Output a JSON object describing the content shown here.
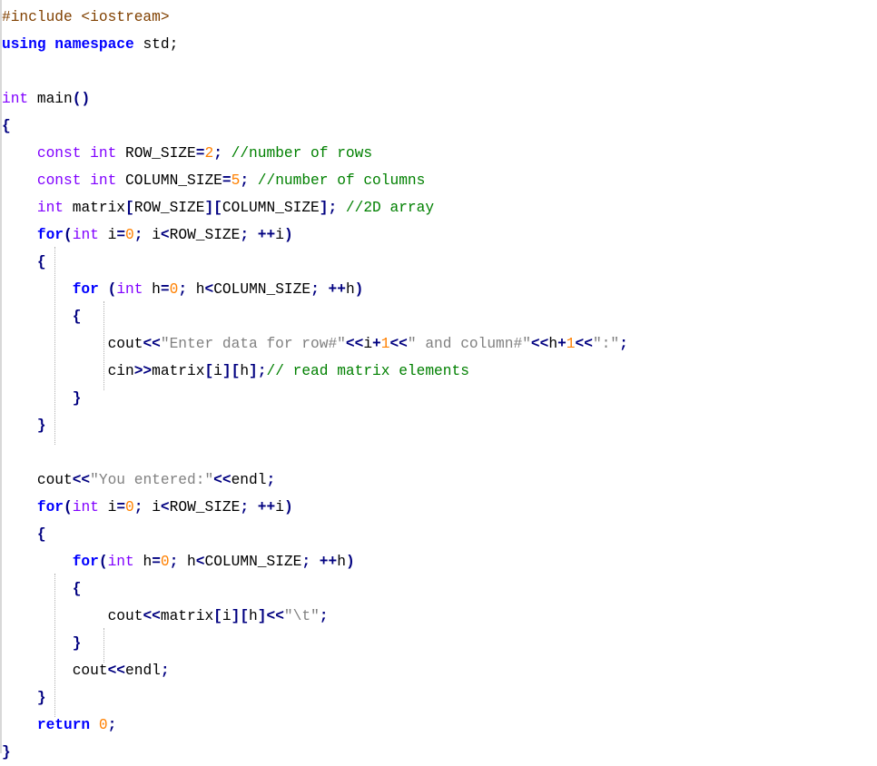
{
  "editor": {
    "language": "C++",
    "lines": [
      [
        {
          "c": "t-pre",
          "t": "#include <iostream>"
        }
      ],
      [
        {
          "c": "t-kw",
          "t": "using"
        },
        {
          "c": "t-plain",
          "t": " "
        },
        {
          "c": "t-kw",
          "t": "namespace"
        },
        {
          "c": "t-plain",
          "t": " std;"
        }
      ],
      [],
      [
        {
          "c": "t-type",
          "t": "int"
        },
        {
          "c": "t-plain",
          "t": " main"
        },
        {
          "c": "t-op",
          "t": "()"
        }
      ],
      [
        {
          "c": "t-op",
          "t": "{"
        }
      ],
      [
        {
          "c": "t-plain",
          "t": "    "
        },
        {
          "c": "t-type",
          "t": "const"
        },
        {
          "c": "t-plain",
          "t": " "
        },
        {
          "c": "t-type",
          "t": "int"
        },
        {
          "c": "t-plain",
          "t": " ROW_SIZE"
        },
        {
          "c": "t-op",
          "t": "="
        },
        {
          "c": "t-num",
          "t": "2"
        },
        {
          "c": "t-op",
          "t": ";"
        },
        {
          "c": "t-plain",
          "t": " "
        },
        {
          "c": "t-cmt",
          "t": "//number of rows"
        }
      ],
      [
        {
          "c": "t-plain",
          "t": "    "
        },
        {
          "c": "t-type",
          "t": "const"
        },
        {
          "c": "t-plain",
          "t": " "
        },
        {
          "c": "t-type",
          "t": "int"
        },
        {
          "c": "t-plain",
          "t": " COLUMN_SIZE"
        },
        {
          "c": "t-op",
          "t": "="
        },
        {
          "c": "t-num",
          "t": "5"
        },
        {
          "c": "t-op",
          "t": ";"
        },
        {
          "c": "t-plain",
          "t": " "
        },
        {
          "c": "t-cmt",
          "t": "//number of columns"
        }
      ],
      [
        {
          "c": "t-plain",
          "t": "    "
        },
        {
          "c": "t-type",
          "t": "int"
        },
        {
          "c": "t-plain",
          "t": " matrix"
        },
        {
          "c": "t-op",
          "t": "["
        },
        {
          "c": "t-plain",
          "t": "ROW_SIZE"
        },
        {
          "c": "t-op",
          "t": "]["
        },
        {
          "c": "t-plain",
          "t": "COLUMN_SIZE"
        },
        {
          "c": "t-op",
          "t": "];"
        },
        {
          "c": "t-plain",
          "t": " "
        },
        {
          "c": "t-cmt",
          "t": "//2D array"
        }
      ],
      [
        {
          "c": "t-plain",
          "t": "    "
        },
        {
          "c": "t-kw",
          "t": "for"
        },
        {
          "c": "t-op",
          "t": "("
        },
        {
          "c": "t-type",
          "t": "int"
        },
        {
          "c": "t-plain",
          "t": " i"
        },
        {
          "c": "t-op",
          "t": "="
        },
        {
          "c": "t-num",
          "t": "0"
        },
        {
          "c": "t-op",
          "t": ";"
        },
        {
          "c": "t-plain",
          "t": " i"
        },
        {
          "c": "t-op",
          "t": "<"
        },
        {
          "c": "t-plain",
          "t": "ROW_SIZE"
        },
        {
          "c": "t-op",
          "t": ";"
        },
        {
          "c": "t-plain",
          "t": " "
        },
        {
          "c": "t-op",
          "t": "++"
        },
        {
          "c": "t-plain",
          "t": "i"
        },
        {
          "c": "t-op",
          "t": ")"
        }
      ],
      [
        {
          "c": "t-plain",
          "t": "    "
        },
        {
          "c": "t-op",
          "t": "{"
        }
      ],
      [
        {
          "c": "t-plain",
          "t": "        "
        },
        {
          "c": "t-kw",
          "t": "for"
        },
        {
          "c": "t-plain",
          "t": " "
        },
        {
          "c": "t-op",
          "t": "("
        },
        {
          "c": "t-type",
          "t": "int"
        },
        {
          "c": "t-plain",
          "t": " h"
        },
        {
          "c": "t-op",
          "t": "="
        },
        {
          "c": "t-num",
          "t": "0"
        },
        {
          "c": "t-op",
          "t": ";"
        },
        {
          "c": "t-plain",
          "t": " h"
        },
        {
          "c": "t-op",
          "t": "<"
        },
        {
          "c": "t-plain",
          "t": "COLUMN_SIZE"
        },
        {
          "c": "t-op",
          "t": ";"
        },
        {
          "c": "t-plain",
          "t": " "
        },
        {
          "c": "t-op",
          "t": "++"
        },
        {
          "c": "t-plain",
          "t": "h"
        },
        {
          "c": "t-op",
          "t": ")"
        }
      ],
      [
        {
          "c": "t-plain",
          "t": "        "
        },
        {
          "c": "t-op",
          "t": "{"
        }
      ],
      [
        {
          "c": "t-plain",
          "t": "            cout"
        },
        {
          "c": "t-op",
          "t": "<<"
        },
        {
          "c": "t-str",
          "t": "\"Enter data for row#\""
        },
        {
          "c": "t-op",
          "t": "<<"
        },
        {
          "c": "t-plain",
          "t": "i"
        },
        {
          "c": "t-op",
          "t": "+"
        },
        {
          "c": "t-num",
          "t": "1"
        },
        {
          "c": "t-op",
          "t": "<<"
        },
        {
          "c": "t-str",
          "t": "\" and column#\""
        },
        {
          "c": "t-op",
          "t": "<<"
        },
        {
          "c": "t-plain",
          "t": "h"
        },
        {
          "c": "t-op",
          "t": "+"
        },
        {
          "c": "t-num",
          "t": "1"
        },
        {
          "c": "t-op",
          "t": "<<"
        },
        {
          "c": "t-str",
          "t": "\":\""
        },
        {
          "c": "t-op",
          "t": ";"
        }
      ],
      [
        {
          "c": "t-plain",
          "t": "            cin"
        },
        {
          "c": "t-op",
          "t": ">>"
        },
        {
          "c": "t-plain",
          "t": "matrix"
        },
        {
          "c": "t-op",
          "t": "["
        },
        {
          "c": "t-plain",
          "t": "i"
        },
        {
          "c": "t-op",
          "t": "]["
        },
        {
          "c": "t-plain",
          "t": "h"
        },
        {
          "c": "t-op",
          "t": "];"
        },
        {
          "c": "t-cmt",
          "t": "// read matrix elements"
        }
      ],
      [
        {
          "c": "t-plain",
          "t": "        "
        },
        {
          "c": "t-op",
          "t": "}"
        }
      ],
      [
        {
          "c": "t-plain",
          "t": "    "
        },
        {
          "c": "t-op",
          "t": "}"
        }
      ],
      [],
      [
        {
          "c": "t-plain",
          "t": "    cout"
        },
        {
          "c": "t-op",
          "t": "<<"
        },
        {
          "c": "t-str",
          "t": "\"You entered:\""
        },
        {
          "c": "t-op",
          "t": "<<"
        },
        {
          "c": "t-plain",
          "t": "endl"
        },
        {
          "c": "t-op",
          "t": ";"
        }
      ],
      [
        {
          "c": "t-plain",
          "t": "    "
        },
        {
          "c": "t-kw",
          "t": "for"
        },
        {
          "c": "t-op",
          "t": "("
        },
        {
          "c": "t-type",
          "t": "int"
        },
        {
          "c": "t-plain",
          "t": " i"
        },
        {
          "c": "t-op",
          "t": "="
        },
        {
          "c": "t-num",
          "t": "0"
        },
        {
          "c": "t-op",
          "t": ";"
        },
        {
          "c": "t-plain",
          "t": " i"
        },
        {
          "c": "t-op",
          "t": "<"
        },
        {
          "c": "t-plain",
          "t": "ROW_SIZE"
        },
        {
          "c": "t-op",
          "t": ";"
        },
        {
          "c": "t-plain",
          "t": " "
        },
        {
          "c": "t-op",
          "t": "++"
        },
        {
          "c": "t-plain",
          "t": "i"
        },
        {
          "c": "t-op",
          "t": ")"
        }
      ],
      [
        {
          "c": "t-plain",
          "t": "    "
        },
        {
          "c": "t-op",
          "t": "{"
        }
      ],
      [
        {
          "c": "t-plain",
          "t": "        "
        },
        {
          "c": "t-kw",
          "t": "for"
        },
        {
          "c": "t-op",
          "t": "("
        },
        {
          "c": "t-type",
          "t": "int"
        },
        {
          "c": "t-plain",
          "t": " h"
        },
        {
          "c": "t-op",
          "t": "="
        },
        {
          "c": "t-num",
          "t": "0"
        },
        {
          "c": "t-op",
          "t": ";"
        },
        {
          "c": "t-plain",
          "t": " h"
        },
        {
          "c": "t-op",
          "t": "<"
        },
        {
          "c": "t-plain",
          "t": "COLUMN_SIZE"
        },
        {
          "c": "t-op",
          "t": ";"
        },
        {
          "c": "t-plain",
          "t": " "
        },
        {
          "c": "t-op",
          "t": "++"
        },
        {
          "c": "t-plain",
          "t": "h"
        },
        {
          "c": "t-op",
          "t": ")"
        }
      ],
      [
        {
          "c": "t-plain",
          "t": "        "
        },
        {
          "c": "t-op",
          "t": "{"
        }
      ],
      [
        {
          "c": "t-plain",
          "t": "            cout"
        },
        {
          "c": "t-op",
          "t": "<<"
        },
        {
          "c": "t-plain",
          "t": "matrix"
        },
        {
          "c": "t-op",
          "t": "["
        },
        {
          "c": "t-plain",
          "t": "i"
        },
        {
          "c": "t-op",
          "t": "]["
        },
        {
          "c": "t-plain",
          "t": "h"
        },
        {
          "c": "t-op",
          "t": "]<<"
        },
        {
          "c": "t-str",
          "t": "\"\\t\""
        },
        {
          "c": "t-op",
          "t": ";"
        }
      ],
      [
        {
          "c": "t-plain",
          "t": "        "
        },
        {
          "c": "t-op",
          "t": "}"
        }
      ],
      [
        {
          "c": "t-plain",
          "t": "        cout"
        },
        {
          "c": "t-op",
          "t": "<<"
        },
        {
          "c": "t-plain",
          "t": "endl"
        },
        {
          "c": "t-op",
          "t": ";"
        }
      ],
      [
        {
          "c": "t-plain",
          "t": "    "
        },
        {
          "c": "t-op",
          "t": "}"
        }
      ],
      [
        {
          "c": "t-plain",
          "t": "    "
        },
        {
          "c": "t-kw",
          "t": "return"
        },
        {
          "c": "t-plain",
          "t": " "
        },
        {
          "c": "t-num",
          "t": "0"
        },
        {
          "c": "t-op",
          "t": ";"
        }
      ],
      [
        {
          "c": "t-op",
          "t": "}"
        }
      ]
    ]
  }
}
